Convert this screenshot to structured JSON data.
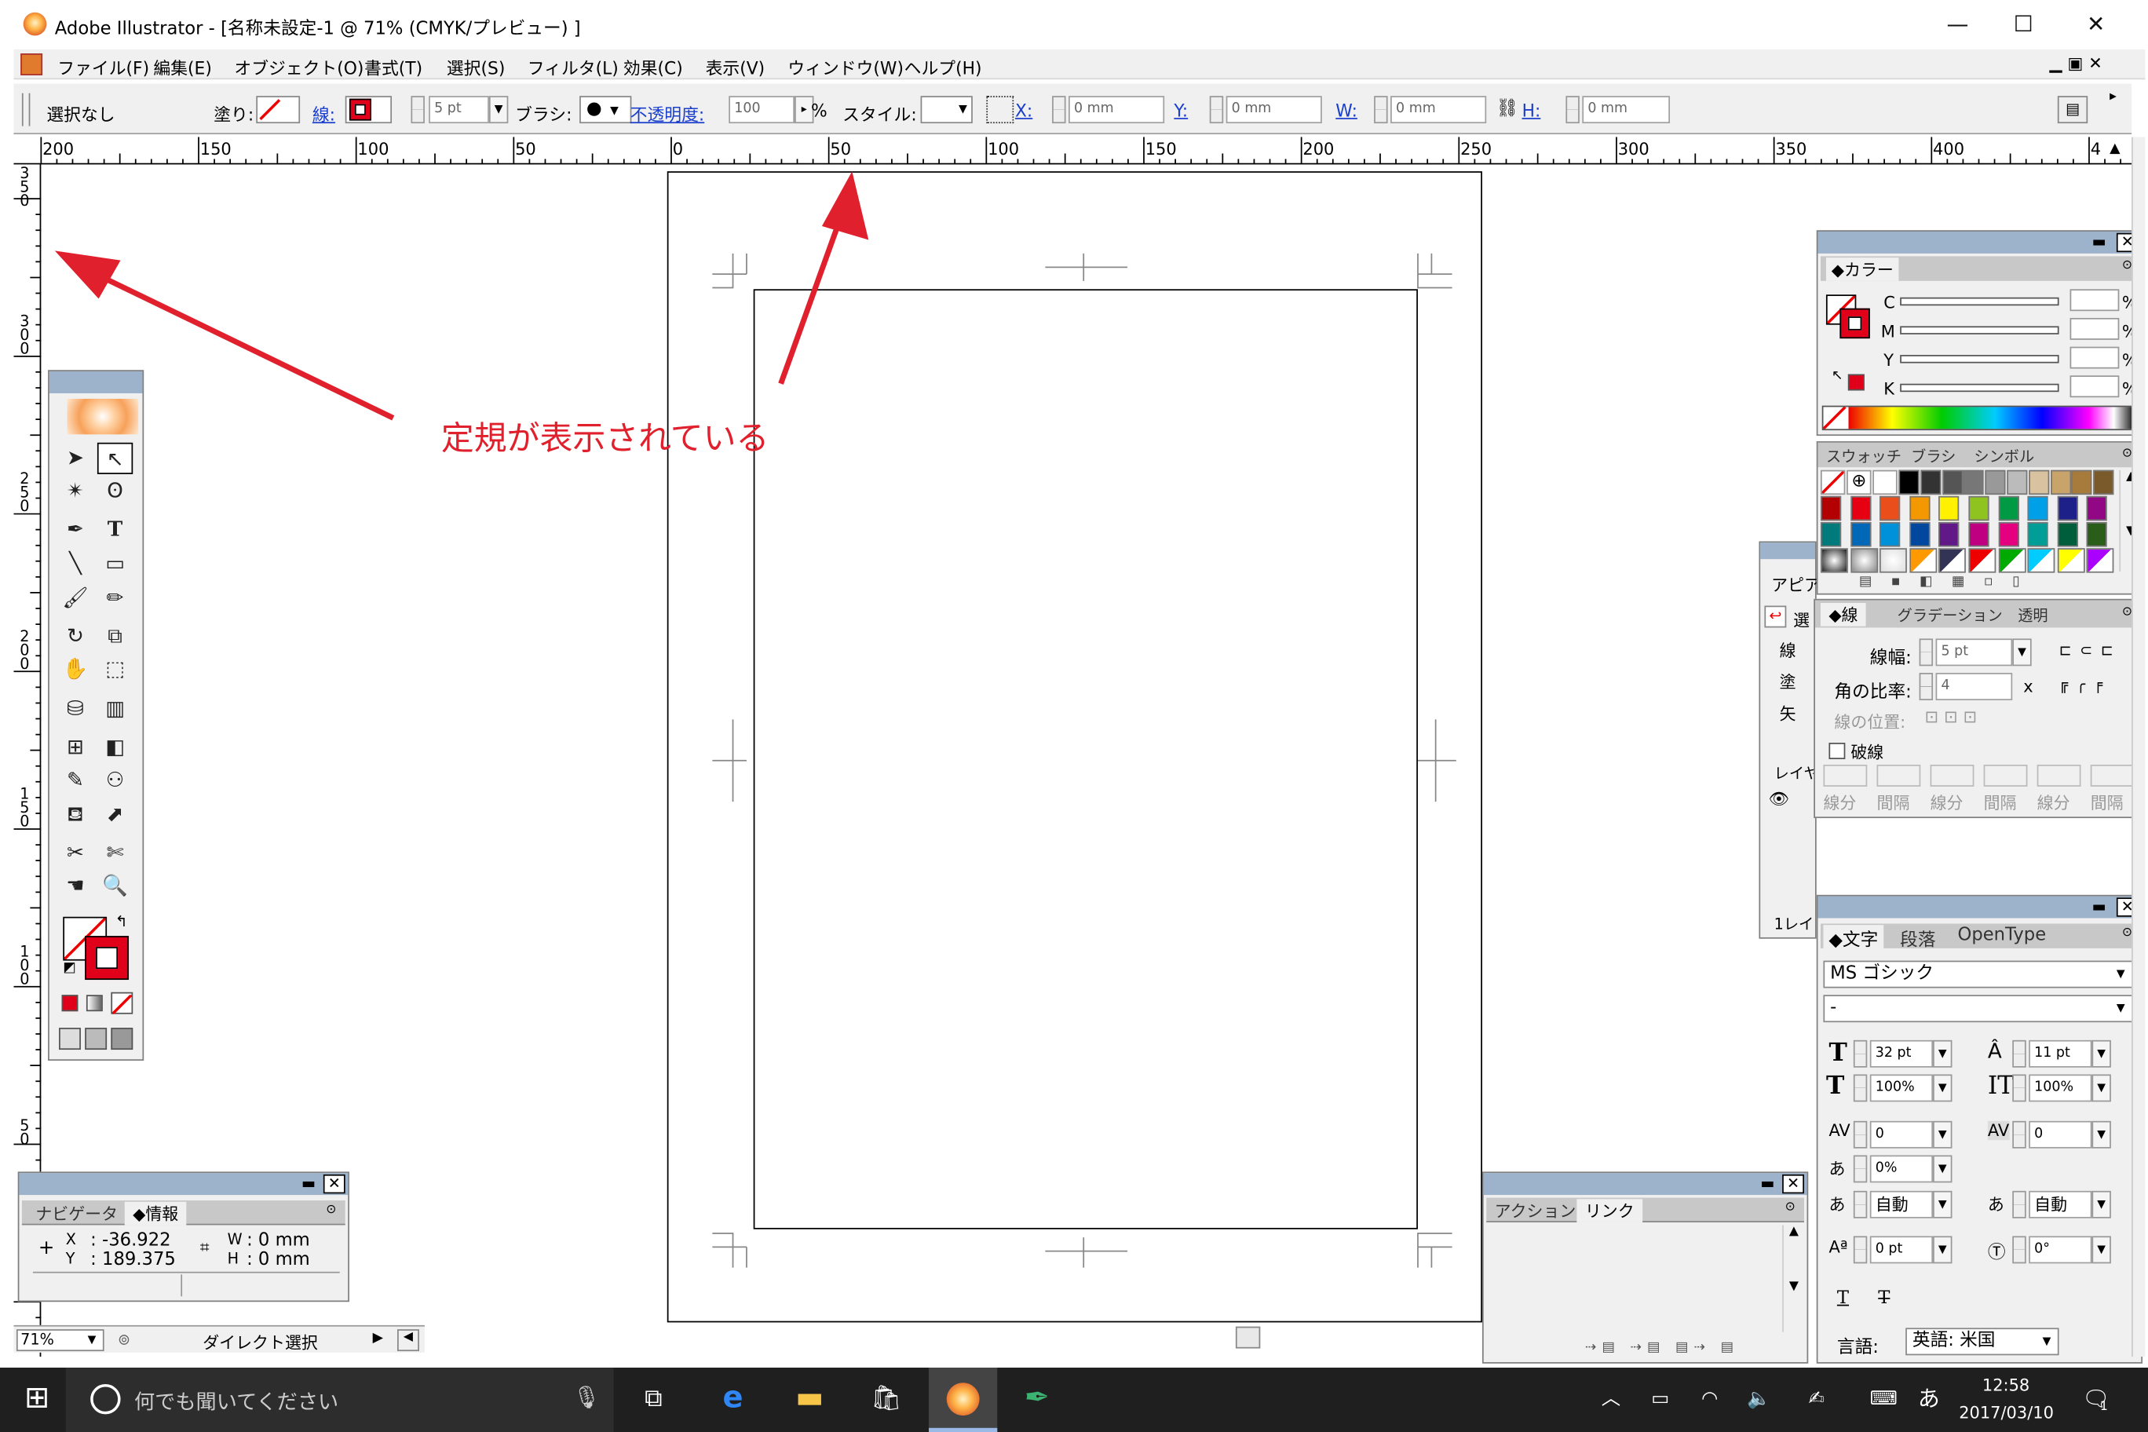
{
  "window": {
    "title": "Adobe Illustrator - [名称未設定-1 @ 71% (CMYK/プレビュー) ]",
    "minimize": "—",
    "maximize": "☐",
    "close": "✕"
  },
  "menu": [
    "ファイル(F)",
    "編集(E)",
    "オブジェクト(O)",
    "書式(T)",
    "選択(S)",
    "フィルタ(L)",
    "効果(C)",
    "表示(V)",
    "ウィンドウ(W)",
    "ヘルプ(H)"
  ],
  "control_bar": {
    "selection_status": "選択なし",
    "fill_label": "塗り:",
    "stroke_label": "線:",
    "stroke_weight": "5 pt",
    "brush_label": "ブラシ:",
    "opacity_label": "不透明度:",
    "opacity_value": "100",
    "percent": "%",
    "style_label": "スタイル:",
    "x_label": "X:",
    "x_value": "0 mm",
    "y_label": "Y:",
    "y_value": "0 mm",
    "w_label": "W:",
    "w_value": "0 mm",
    "h_label": "H:",
    "h_value": "0 mm"
  },
  "ruler_h": [
    "200",
    "150",
    "100",
    "50",
    "0",
    "50",
    "100",
    "150",
    "200",
    "250",
    "300",
    "350",
    "400",
    "4"
  ],
  "ruler_v": [
    [
      "3",
      "5",
      "0"
    ],
    [
      "3",
      "0",
      "0"
    ],
    [
      "2",
      "5",
      "0"
    ],
    [
      "2",
      "0",
      "0"
    ],
    [
      "1",
      "5",
      "0"
    ],
    [
      "1",
      "0",
      "0"
    ],
    [
      "5",
      "0"
    ]
  ],
  "annotation": "定規が表示されている",
  "color_panel": {
    "tab": "◆カラー",
    "channels": [
      "C",
      "M",
      "Y",
      "K"
    ],
    "percent": "%"
  },
  "swatches_panel": {
    "tabs": [
      "スウォッチ",
      "ブラシ",
      "シンボル"
    ],
    "colors": [
      "#000000",
      "#333333",
      "#555555",
      "#777777",
      "#999999",
      "#bbbbbb",
      "#d9c2a0",
      "#c9a46a",
      "#a77b3c",
      "#7a5a2a",
      "#b30000",
      "#e60012",
      "#e94e1b",
      "#f39800",
      "#fff100",
      "#8fc31f",
      "#009944",
      "#00a0e9",
      "#1d2088",
      "#920783",
      "#007a7a",
      "#0068b7",
      "#0091db",
      "#00479d",
      "#601986",
      "#be0081",
      "#e4007f",
      "#009e96",
      "#005e3c",
      "#2a5c1a"
    ]
  },
  "appearance_panel": {
    "tab": "アピア",
    "rows": [
      "選",
      "線",
      "塗",
      "矢"
    ],
    "layers_tab": "レイヤ",
    "layers_count": "1レイ"
  },
  "stroke_panel": {
    "tabs": [
      "◆線",
      "グラデーション",
      "透明"
    ],
    "weight_label": "線幅:",
    "weight_value": "5 pt",
    "miter_label": "角の比率:",
    "miter_value": "4",
    "miter_unit": "x",
    "align_label": "線の位置:",
    "dashed_label": "破線",
    "dash_labels": [
      "線分",
      "間隔",
      "線分",
      "間隔",
      "線分",
      "間隔"
    ]
  },
  "character_panel": {
    "tabs": [
      "◆文字",
      "段落",
      "OpenType"
    ],
    "font_family": "MS ゴシック",
    "font_style": "-",
    "font_size": "32 pt",
    "leading": "11 pt",
    "h_scale": "100%",
    "v_scale": "100%",
    "kerning": "0",
    "tracking": "0",
    "tsume": "0%",
    "aki_left": "自動",
    "aki_right": "自動",
    "baseline": "0 pt",
    "rotation": "0°",
    "language_label": "言語:",
    "language_value": "英語: 米国"
  },
  "info_panel": {
    "tabs": [
      "ナビゲータ",
      "◆情報"
    ],
    "x_label": "X",
    "x_value": ": -36.922",
    "y_label": "Y",
    "y_value": ": 189.375",
    "w_label": "W",
    "w_value": ": 0 mm",
    "h_label": "H",
    "h_value": ": 0 mm"
  },
  "actions_panel": {
    "tabs": [
      "アクション",
      "リンク"
    ]
  },
  "status_bar": {
    "zoom": "71%",
    "tool_name": "ダイレクト選択"
  },
  "taskbar": {
    "search_placeholder": "何でも聞いてください",
    "time": "12:58",
    "date": "2017/03/10",
    "ime": "あ",
    "notification_count": "1"
  },
  "colors": {
    "accent_red": "#e0202c",
    "panel_title": "#9db3cc",
    "taskbar": "#1f1f1f"
  }
}
